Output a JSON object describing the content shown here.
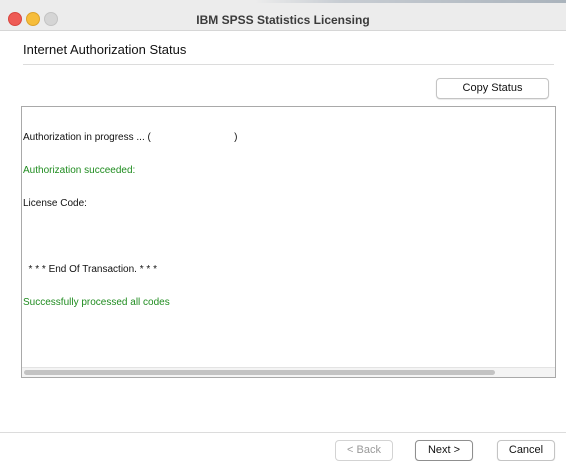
{
  "window": {
    "title": "IBM SPSS Statistics Licensing"
  },
  "page": {
    "heading": "Internet Authorization Status"
  },
  "toolbar": {
    "copy_status_label": "Copy Status"
  },
  "status": {
    "lines": [
      {
        "text": "Authorization in progress ... (                              )",
        "color": "#111111"
      },
      {
        "text": "Authorization succeeded:",
        "color": "#1f8c1f"
      },
      {
        "text": "License Code:",
        "color": "#111111"
      },
      {
        "text": "",
        "color": "#111111"
      },
      {
        "text": "  * * * End Of Transaction. * * *",
        "color": "#111111"
      },
      {
        "text": "Successfully processed all codes",
        "color": "#1f8c1f"
      }
    ]
  },
  "footer": {
    "back_label": "< Back",
    "next_label": "Next >",
    "cancel_label": "Cancel"
  }
}
